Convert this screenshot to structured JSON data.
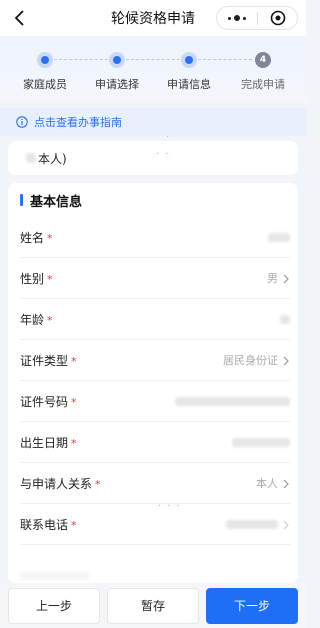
{
  "navbar": {
    "title": "轮候资格申请",
    "back_icon": "chevron-left-icon",
    "more_icon": "more-dots-icon",
    "close_icon": "target-circle-icon"
  },
  "steps": [
    {
      "label": "家庭成员",
      "status": "done"
    },
    {
      "label": "申请选择",
      "status": "done"
    },
    {
      "label": "申请信息",
      "status": "current"
    },
    {
      "label": "完成申请",
      "status": "todo",
      "number": "4"
    }
  ],
  "guide": {
    "text": "点击查看办事指南",
    "icon": "info-circle-icon"
  },
  "person_tab": {
    "label": "本人)"
  },
  "section": {
    "title": "基本信息",
    "fields": [
      {
        "label": "姓名",
        "required": "*",
        "value": "",
        "placeholder": "",
        "chevron": false
      },
      {
        "label": "性别",
        "required": "*",
        "value": "男",
        "chevron": true
      },
      {
        "label": "年龄",
        "required": "*",
        "value": "",
        "chevron": false
      },
      {
        "label": "证件类型",
        "required": "*",
        "value": "居民身份证",
        "chevron": true
      },
      {
        "label": "证件号码",
        "required": "*",
        "value": "",
        "chevron": false
      },
      {
        "label": "出生日期",
        "required": "*",
        "value": "",
        "chevron": false
      },
      {
        "label": "与申请人关系",
        "required": "*",
        "value": "本人",
        "chevron": true
      },
      {
        "label": "联系电话",
        "required": "*",
        "value": "",
        "chevron": true
      }
    ]
  },
  "footer": {
    "prev_label": "上一步",
    "save_label": "暂存",
    "next_label": "下一步"
  },
  "colors": {
    "accent": "#1e6ff5",
    "required": "#ee3333"
  }
}
